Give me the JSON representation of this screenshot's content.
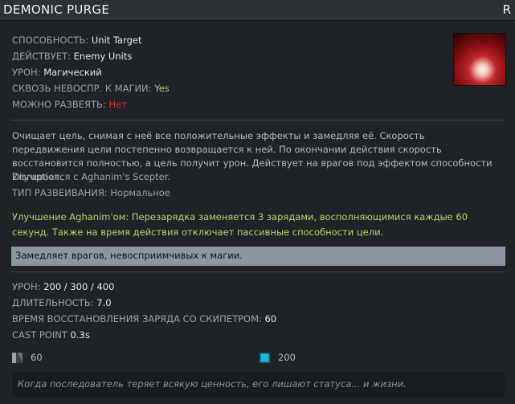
{
  "header": {
    "title": "DEMONIC PURGE",
    "hotkey": "R"
  },
  "props": {
    "ability": {
      "label": "СПОСОБНОСТЬ:",
      "value": "Unit Target"
    },
    "affects": {
      "label": "ДЕЙСТВУЕТ:",
      "value": "Enemy Units"
    },
    "damage_type": {
      "label": "УРОН:",
      "value": "Магический"
    },
    "pierces": {
      "label": "СКВОЗЬ НЕВОСПР. К МАГИИ:",
      "value": "Yes"
    },
    "dispellable": {
      "label": "МОЖНО РАЗВЕЯТЬ:",
      "value": "Нет"
    }
  },
  "description": "Очищает цель, снимая с неё все положительные эффекты и замедляя её. Скорость передвижения цели постепенно возвращается к ней. По окончании действия скорость восстановится полностью, а цель получит урон. Действует на врагов под эффектом способности Disruption.",
  "upgrade_note": "Улучшается с Aghanim's Scepter.",
  "dispel_type": {
    "label": "ТИП РАЗВЕИВАНИЯ:",
    "value": "Нормальное"
  },
  "aghanim_text": "Улучшение Aghanim'ом: Перезарядка заменяется 3 зарядами, восполняющимися каждые 60 секунд. Также на время действия отключает пассивные способности цели.",
  "note": "Замедляет врагов, невосприимчивых к магии.",
  "stats": {
    "damage": {
      "label": "УРОН:",
      "value": "200 / 300 / 400"
    },
    "duration": {
      "label": "ДЛИТЕЛЬНОСТЬ:",
      "value": "7.0"
    },
    "charge_restore": {
      "label": "ВРЕМЯ ВОССТАНОВЛЕНИЯ ЗАРЯДА СО СКИПЕТРОМ:",
      "value": "60"
    },
    "cast_point": {
      "label": "CAST POINT",
      "value": "0.3s"
    }
  },
  "costs": {
    "cooldown": "60",
    "mana": "200"
  },
  "lore": "Когда последователь теряет всякую ценность, его лишают статуса... и жизни.",
  "colors": {
    "green": "#b7d36a",
    "red": "#d5312f",
    "mana": "#1fb6d9"
  },
  "icons": {
    "ability": "demonic-purge-ability-icon",
    "cooldown": "cooldown-icon",
    "mana": "mana-icon"
  }
}
